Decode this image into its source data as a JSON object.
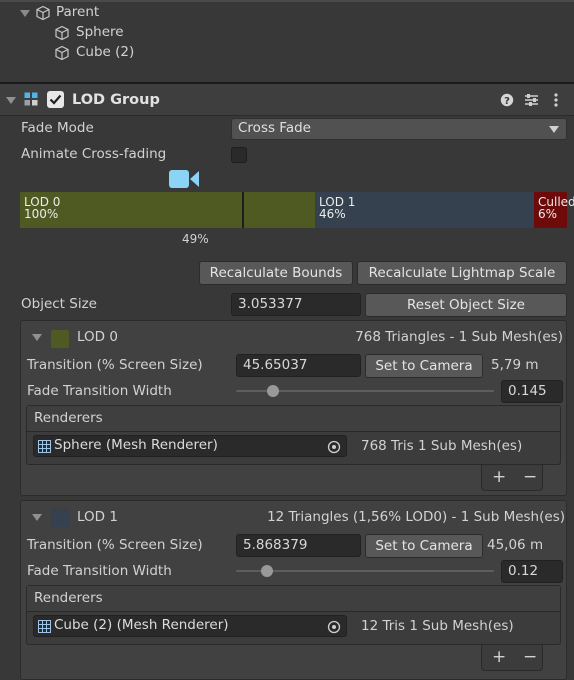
{
  "hierarchy": {
    "items": [
      {
        "label": "Parent"
      },
      {
        "label": "Sphere"
      },
      {
        "label": "Cube (2)"
      }
    ]
  },
  "component": {
    "title": "LOD Group",
    "enabled": true
  },
  "fade_mode": {
    "label": "Fade Mode",
    "value": "Cross Fade"
  },
  "animate_cross_fading": {
    "label": "Animate Cross-fading",
    "checked": false
  },
  "lod_bar": {
    "segments": [
      {
        "name": "LOD 0",
        "percent": "100%",
        "fraction": 0.54,
        "color": "#4f5a23"
      },
      {
        "name": "LOD 1",
        "percent": "46%",
        "fraction": 0.4,
        "color": "#35414f"
      },
      {
        "name": "Culled",
        "percent": "6%",
        "fraction": 0.06,
        "color": "#6e0a0a"
      }
    ],
    "marker": "49%"
  },
  "buttons": {
    "recalc_bounds": "Recalculate Bounds",
    "recalc_lightmap": "Recalculate Lightmap Scale"
  },
  "object_size": {
    "label": "Object Size",
    "value": "3.053377",
    "reset": "Reset Object Size"
  },
  "lods": [
    {
      "name": "LOD 0",
      "summary": "768 Triangles  - 1 Sub Mesh(es)",
      "transition_label": "Transition (% Screen Size)",
      "transition_value": "45.65037",
      "set_camera": "Set to Camera",
      "distance": "5,79 m",
      "fade_label": "Fade Transition Width",
      "fade_value": "0.145",
      "fade_level": 0.145,
      "renderers_label": "Renderers",
      "renderer": "Sphere (Mesh Renderer)",
      "renderer_info": "768 Tris 1 Sub Mesh(es)",
      "color": "#4f5a23"
    },
    {
      "name": "LOD 1",
      "summary": "12 Triangles (1,56% LOD0) - 1 Sub Mesh(es)",
      "transition_label": "Transition (% Screen Size)",
      "transition_value": "5.868379",
      "set_camera": "Set to Camera",
      "distance": "45,06 m",
      "fade_label": "Fade Transition Width",
      "fade_value": "0.12",
      "fade_level": 0.12,
      "renderers_label": "Renderers",
      "renderer": "Cube (2) (Mesh Renderer)",
      "renderer_info": "12 Tris 1 Sub Mesh(es)",
      "color": "#35414f"
    }
  ],
  "icons": {
    "plus": "+",
    "minus": "−"
  }
}
